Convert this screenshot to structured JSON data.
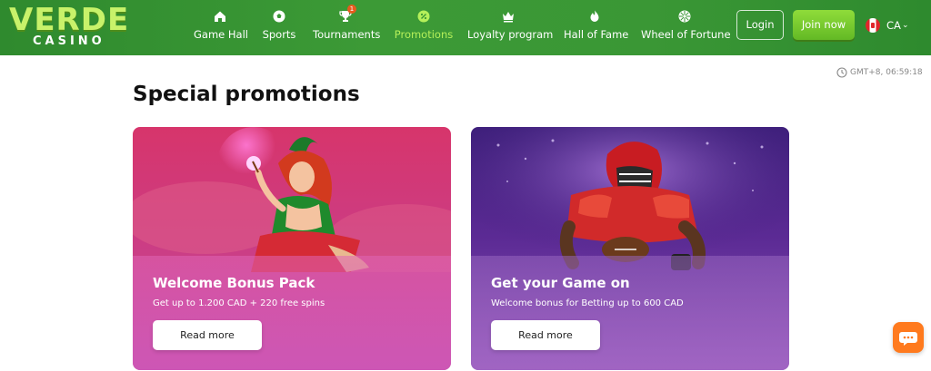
{
  "header": {
    "logo": {
      "top": "VERDE",
      "bottom": "CASINO"
    },
    "nav": [
      {
        "label": "Game Hall",
        "icon": "home-icon",
        "active": false
      },
      {
        "label": "Sports",
        "icon": "soccer-ball-icon",
        "active": false
      },
      {
        "label": "Tournaments",
        "icon": "trophy-icon",
        "active": false,
        "badge": "1"
      },
      {
        "label": "Promotions",
        "icon": "promo-badge-icon",
        "active": true
      },
      {
        "label": "Loyalty program",
        "icon": "crown-icon",
        "active": false
      },
      {
        "label": "Hall of Fame",
        "icon": "flame-icon",
        "active": false
      },
      {
        "label": "Wheel of Fortune",
        "icon": "wheel-icon",
        "active": false
      }
    ],
    "login_label": "Login",
    "join_label": "Join now",
    "language": "CA"
  },
  "clock_text": "GMT+8, 06:59:18",
  "page_title": "Special promotions",
  "cards": [
    {
      "title": "Welcome Bonus Pack",
      "subtitle": "Get up to 1.200 CAD + 220 free spins",
      "button": "Read more"
    },
    {
      "title": "Get your Game on",
      "subtitle": "Welcome bonus for Betting up to 600 CAD",
      "button": "Read more"
    }
  ],
  "colors": {
    "header_green": "#3a9735",
    "active_nav": "#b5f05a",
    "join_button": "#7ccb30",
    "chat_button": "#ff7a1e"
  }
}
